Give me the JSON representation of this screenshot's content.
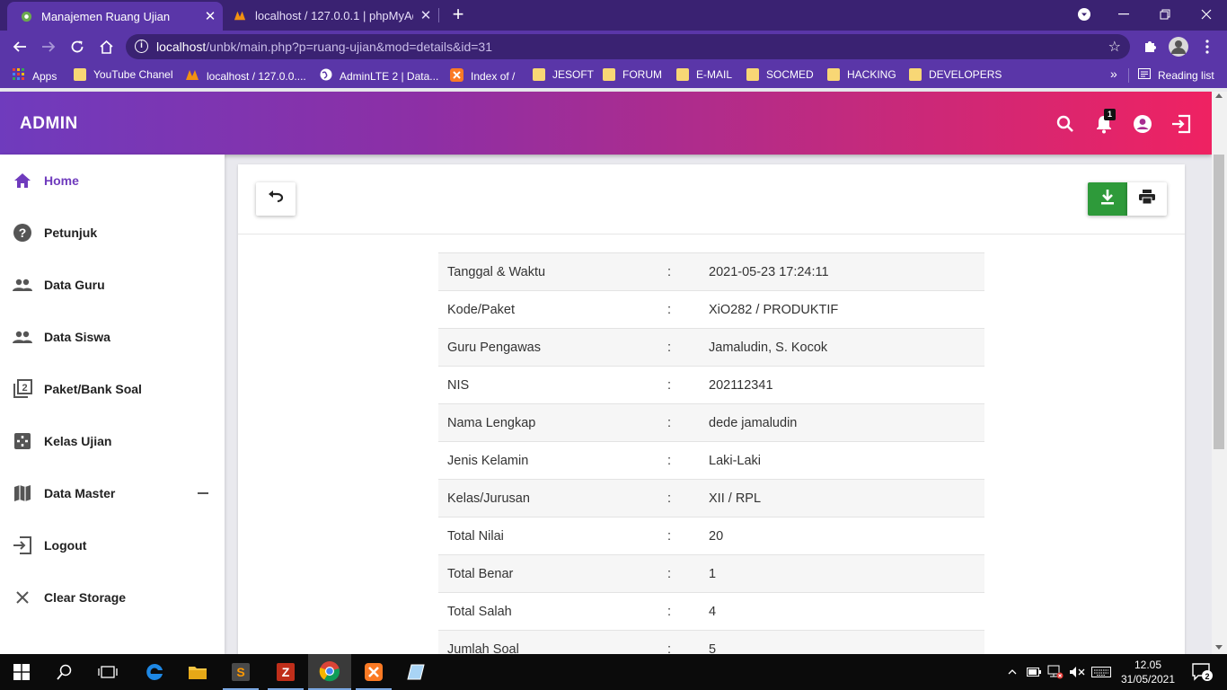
{
  "browser": {
    "tabs": [
      {
        "title": "Manajemen Ruang Ujian",
        "active": true
      },
      {
        "title": "localhost / 127.0.0.1 | phpMyAdmin",
        "active": false
      }
    ],
    "url": {
      "host": "localhost",
      "path": "/unbk/main.php?p=ruang-ujian&mod=details&id=31"
    },
    "bookmarks": [
      {
        "label": "Apps",
        "icon": "apps-grid-icon"
      },
      {
        "label": "YouTube Chanel",
        "icon": "folder-icon"
      },
      {
        "label": "localhost / 127.0.0....",
        "icon": "phpmyadmin-icon"
      },
      {
        "label": "AdminLTE 2 | Data...",
        "icon": "globe-icon"
      },
      {
        "label": "Index of /",
        "icon": "xampp-icon"
      },
      {
        "label": "JESOFT",
        "icon": "folder-icon"
      },
      {
        "label": "FORUM",
        "icon": "folder-icon"
      },
      {
        "label": "E-MAIL",
        "icon": "folder-icon"
      },
      {
        "label": "SOCMED",
        "icon": "folder-icon"
      },
      {
        "label": "HACKING",
        "icon": "folder-icon"
      },
      {
        "label": "DEVELOPERS",
        "icon": "folder-icon"
      }
    ],
    "more_bookmarks": "»",
    "reading_list": "Reading list"
  },
  "header": {
    "brand": "ADMIN",
    "notification_count": "1"
  },
  "sidebar": {
    "items": [
      {
        "label": "Home",
        "icon": "home-icon",
        "active": true
      },
      {
        "label": "Petunjuk",
        "icon": "help-circle-icon"
      },
      {
        "label": "Data Guru",
        "icon": "people-icon"
      },
      {
        "label": "Data Siswa",
        "icon": "people-icon"
      },
      {
        "label": "Paket/Bank Soal",
        "icon": "filter-2-icon"
      },
      {
        "label": "Kelas Ujian",
        "icon": "exam-class-icon"
      },
      {
        "label": "Data Master",
        "icon": "map-icon"
      },
      {
        "label": "Logout",
        "icon": "logout-icon"
      },
      {
        "label": "Clear Storage",
        "icon": "close-icon"
      }
    ]
  },
  "details": {
    "rows": [
      {
        "key": "Tanggal & Waktu",
        "sep": ":",
        "value": "2021-05-23 17:24:11"
      },
      {
        "key": "Kode/Paket",
        "sep": ":",
        "value": "XiO282 / PRODUKTIF"
      },
      {
        "key": "Guru Pengawas",
        "sep": ":",
        "value": "Jamaludin, S. Kocok"
      },
      {
        "key": "NIS",
        "sep": ":",
        "value": "202112341"
      },
      {
        "key": "Nama Lengkap",
        "sep": ":",
        "value": "dede jamaludin"
      },
      {
        "key": "Jenis Kelamin",
        "sep": ":",
        "value": "Laki-Laki"
      },
      {
        "key": "Kelas/Jurusan",
        "sep": ":",
        "value": "XII / RPL"
      },
      {
        "key": "Total Nilai",
        "sep": ":",
        "value": "20"
      },
      {
        "key": "Total Benar",
        "sep": ":",
        "value": "1"
      },
      {
        "key": "Total Salah",
        "sep": ":",
        "value": "4"
      },
      {
        "key": "Jumlah Soal",
        "sep": ":",
        "value": "5"
      }
    ]
  },
  "taskbar": {
    "time": "12.05",
    "date": "31/05/2021",
    "notifications": "2"
  },
  "colors": {
    "accent": "#6f3bbd",
    "header_gradient_start": "#6f3bbd",
    "header_gradient_end": "#ef2262",
    "download_button": "#2e9a3a"
  }
}
